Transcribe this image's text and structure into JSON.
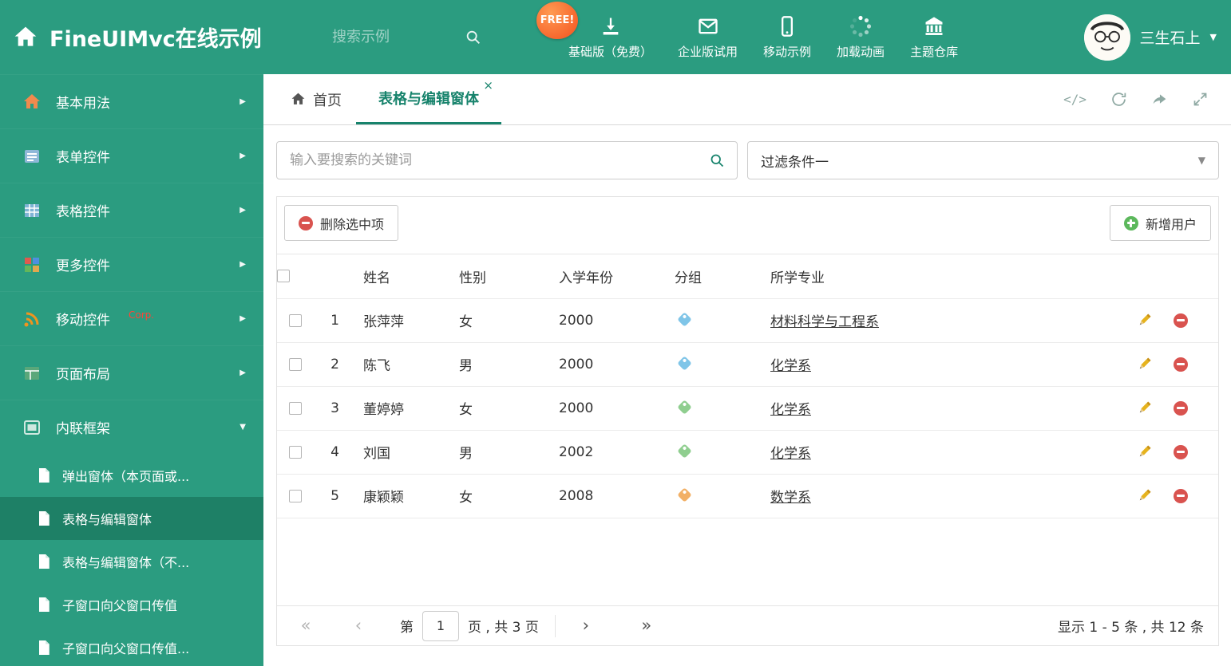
{
  "colors": {
    "theme": "#2b9c80",
    "theme_dark": "#1e8066",
    "accent": "#17836c",
    "red": "#d9534f",
    "green": "#5cb85c",
    "gold": "#e6b31e",
    "free_badge": "#f4511e"
  },
  "icons": {
    "caret_right": "▶",
    "caret_down": "▼",
    "close": "×",
    "code": "</>",
    "first": "«",
    "prev": "‹",
    "next": "›",
    "last": "»"
  },
  "header": {
    "title": "FineUIMvc在线示例",
    "search_placeholder": "搜索示例",
    "free_badge": "FREE!",
    "nav": [
      {
        "label": "基础版（免费）"
      },
      {
        "label": "企业版试用"
      },
      {
        "label": "移动示例"
      },
      {
        "label": "加载动画"
      },
      {
        "label": "主题仓库"
      }
    ],
    "user_name": "三生石上"
  },
  "sidebar": {
    "items": [
      {
        "label": "基本用法"
      },
      {
        "label": "表单控件"
      },
      {
        "label": "表格控件"
      },
      {
        "label": "更多控件"
      },
      {
        "label": "移动控件",
        "badge": "Corp."
      },
      {
        "label": "页面布局"
      },
      {
        "label": "内联框架"
      }
    ],
    "subitems": [
      {
        "label": "弹出窗体（本页面或..."
      },
      {
        "label": "表格与编辑窗体"
      },
      {
        "label": "表格与编辑窗体（不..."
      },
      {
        "label": "子窗口向父窗口传值"
      },
      {
        "label": "子窗口向父窗口传值..."
      }
    ]
  },
  "tabs": [
    {
      "label": "首页"
    },
    {
      "label": "表格与编辑窗体"
    }
  ],
  "filters": {
    "search_placeholder": "输入要搜索的关键词",
    "selected_filter": "过滤条件一"
  },
  "toolbar": {
    "delete_label": "删除选中项",
    "add_label": "新增用户"
  },
  "table": {
    "columns": [
      "姓名",
      "性别",
      "入学年份",
      "分组",
      "所学专业"
    ],
    "rows": [
      {
        "num": "1",
        "name": "张萍萍",
        "gender": "女",
        "year": "2000",
        "tag_color": "#7fc5e8",
        "major": "材料科学与工程系"
      },
      {
        "num": "2",
        "name": "陈飞",
        "gender": "男",
        "year": "2000",
        "tag_color": "#7fc5e8",
        "major": "化学系"
      },
      {
        "num": "3",
        "name": "董婷婷",
        "gender": "女",
        "year": "2000",
        "tag_color": "#8fce8f",
        "major": "化学系"
      },
      {
        "num": "4",
        "name": "刘国",
        "gender": "男",
        "year": "2002",
        "tag_color": "#8fce8f",
        "major": "化学系"
      },
      {
        "num": "5",
        "name": "康颖颖",
        "gender": "女",
        "year": "2008",
        "tag_color": "#f2b066",
        "major": "数学系"
      }
    ]
  },
  "pagination": {
    "page_label_prefix": "第",
    "current_page": "1",
    "page_label_suffix": "页 , 共 3 页",
    "summary": "显示 1 - 5 条 , 共 12 条"
  }
}
